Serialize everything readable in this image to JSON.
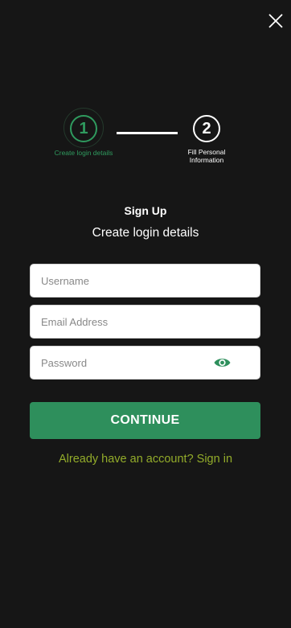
{
  "colors": {
    "background": "#161616",
    "accent_green": "#2e8f5c",
    "step_active": "#2f9a5e",
    "link_color": "#93ac2a"
  },
  "icons": {
    "close": "close-icon",
    "password_toggle": "eye-icon"
  },
  "stepper": {
    "step1": {
      "number": "1",
      "label": "Create login details",
      "state": "active"
    },
    "step2": {
      "number": "2",
      "label_line1": "Fill Personal",
      "label_line2": "Information",
      "state": "upcoming"
    }
  },
  "form": {
    "title": "Sign Up",
    "subtitle": "Create login details",
    "username": {
      "placeholder": "Username",
      "value": ""
    },
    "email": {
      "placeholder": "Email Address",
      "value": ""
    },
    "password": {
      "placeholder": "Password",
      "value": ""
    },
    "continue_label": "CONTINUE",
    "signin_text": "Already have an account? Sign in"
  }
}
